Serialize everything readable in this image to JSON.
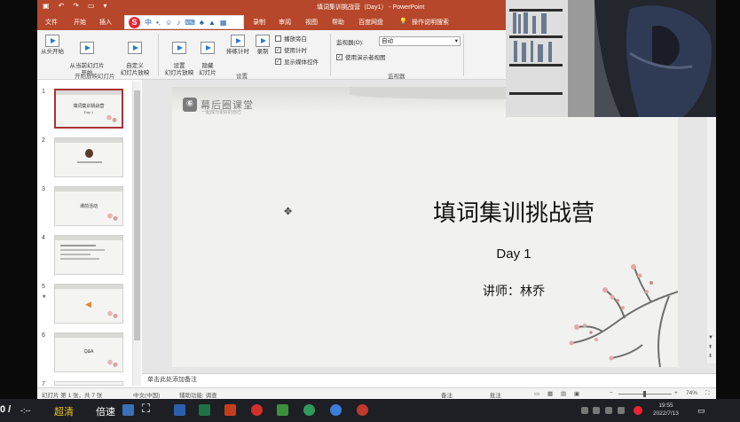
{
  "title_bar": {
    "document_title": "填词集训挑战营（Day1） - PowerPoint",
    "quick_access": [
      "save-icon",
      "undo-icon",
      "redo-icon",
      "present-icon",
      "more-icon"
    ]
  },
  "ime_toolbar": {
    "logo_letter": "S",
    "mode": "中",
    "items": [
      "punct-icon",
      "emoji-icon",
      "mic-icon",
      "keyboard-icon",
      "skin-icon",
      "tools-icon",
      "grid-icon"
    ]
  },
  "menu_tabs": [
    "文件",
    "开始",
    "插入",
    "录制",
    "审阅",
    "视图",
    "帮助",
    "百度网盘",
    "操作说明搜索"
  ],
  "ribbon": {
    "groups": [
      {
        "label": "开始放映幻灯片",
        "buttons": [
          "从头开始",
          "从当前幻灯片\n开始",
          "自定义\n幻灯片放映"
        ]
      },
      {
        "label": "设置",
        "buttons": [
          "设置\n幻灯片放映",
          "隐藏\n幻灯片",
          "排练计时",
          "录制"
        ],
        "checkboxes": [
          {
            "label": "播放旁白",
            "checked": false
          },
          {
            "label": "使用计时",
            "checked": true
          },
          {
            "label": "显示媒体控件",
            "checked": true
          }
        ]
      },
      {
        "label": "监视器",
        "monitor_label": "监视器(O):",
        "monitor_value": "自动",
        "presenter_view_label": "使用演示者视图",
        "presenter_view_checked": true
      }
    ]
  },
  "thumbnails": [
    {
      "number": "1",
      "title": "填词集训挑战营",
      "subtitle": "Day 1",
      "selected": true
    },
    {
      "number": "2",
      "title": "",
      "subtitle": "",
      "selected": false
    },
    {
      "number": "3",
      "title": "课前活动",
      "subtitle": "",
      "selected": false
    },
    {
      "number": "4",
      "title": "",
      "subtitle": "",
      "selected": false
    },
    {
      "number": "5",
      "title": "",
      "subtitle": "",
      "selected": false
    },
    {
      "number": "6",
      "title": "Q&A",
      "subtitle": "",
      "selected": false
    },
    {
      "number": "7",
      "title": "",
      "subtitle": "",
      "selected": false
    }
  ],
  "slide": {
    "logo_name": "幕后圈课堂",
    "logo_sub": "一起成为更好的自己",
    "title": "填词集训挑战营",
    "day": "Day 1",
    "teacher": "讲师：林乔"
  },
  "notes_placeholder": "单击此处添加备注",
  "status_bar": {
    "slide_info": "幻灯片 第 1 张，共 7 张",
    "language": "中文(中国)",
    "accessibility": "辅助功能: 调查",
    "notes_label": "备注",
    "comments_label": "批注",
    "zoom": "74%"
  },
  "taskbar": {
    "left_counter": "0 /",
    "dashes": "-:--",
    "quality": "超清",
    "speed": "倍速",
    "time": "19:55",
    "date": "2022/7/13"
  }
}
